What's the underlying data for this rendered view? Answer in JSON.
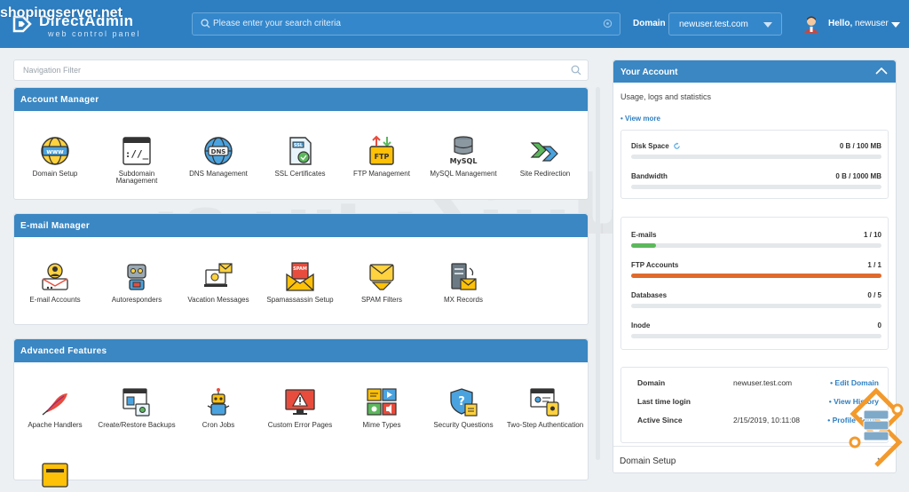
{
  "header": {
    "watermark": "shopingserver.net",
    "brand_name": "DirectAdmin",
    "brand_sub": "web control panel",
    "search_placeholder": "Please enter your search criteria",
    "domain_label": "Domain",
    "domain_value": "newuser.test.com",
    "hello": "Hello,",
    "username": "newuser"
  },
  "nav_filter": {
    "placeholder": "Navigation Filter"
  },
  "sections": [
    {
      "title": "Account Manager",
      "items": [
        {
          "label": "Domain Setup",
          "icon": "www-globe-icon"
        },
        {
          "label": "Subdomain Management",
          "icon": "subdomain-window-icon"
        },
        {
          "label": "DNS Management",
          "icon": "dns-globe-icon"
        },
        {
          "label": "SSL Certificates",
          "icon": "ssl-certificate-icon"
        },
        {
          "label": "FTP Management",
          "icon": "ftp-folder-icon"
        },
        {
          "label": "MySQL Management",
          "icon": "mysql-database-icon"
        },
        {
          "label": "Site Redirection",
          "icon": "redirect-arrows-icon"
        }
      ]
    },
    {
      "title": "E-mail Manager",
      "items": [
        {
          "label": "E-mail Accounts",
          "icon": "email-account-icon"
        },
        {
          "label": "Autoresponders",
          "icon": "robot-icon"
        },
        {
          "label": "Vacation Messages",
          "icon": "vacation-laptop-icon"
        },
        {
          "label": "Spamassassin Setup",
          "icon": "spam-envelope-icon"
        },
        {
          "label": "SPAM Filters",
          "icon": "spam-filter-icon"
        },
        {
          "label": "MX Records",
          "icon": "mx-server-icon"
        }
      ]
    },
    {
      "title": "Advanced Features",
      "items": [
        {
          "label": "Apache Handlers",
          "icon": "apache-feather-icon"
        },
        {
          "label": "Create/Restore Backups",
          "icon": "backup-window-icon"
        },
        {
          "label": "Cron Jobs",
          "icon": "cron-robot-icon"
        },
        {
          "label": "Custom Error Pages",
          "icon": "error-monitor-icon"
        },
        {
          "label": "Mime Types",
          "icon": "mime-types-icon"
        },
        {
          "label": "Security Questions",
          "icon": "security-question-icon"
        },
        {
          "label": "Two-Step Authentication",
          "icon": "two-step-auth-icon"
        }
      ]
    }
  ],
  "account": {
    "title": "Your Account",
    "description": "Usage, logs and statistics",
    "view_more": "• View more",
    "usage_top": [
      {
        "name": "Disk Space",
        "value": "0 B / 100 MB",
        "fraction": 0
      },
      {
        "name": "Bandwidth",
        "value": "0 B / 1000 MB",
        "fraction": 0
      }
    ],
    "usage_bottom": [
      {
        "name": "E-mails",
        "value": "1 / 10",
        "fraction": 0.1,
        "color": "#5cb85c"
      },
      {
        "name": "FTP Accounts",
        "value": "1 / 1",
        "fraction": 1,
        "color": "#e06a2c"
      },
      {
        "name": "Databases",
        "value": "0 / 5",
        "fraction": 0,
        "color": "#5cb85c"
      },
      {
        "name": "Inode",
        "value": "0",
        "fraction": 0,
        "color": "#5cb85c"
      }
    ],
    "info": [
      {
        "key": "Domain",
        "value": "newuser.test.com",
        "action": "• Edit Domain"
      },
      {
        "key": "Last time login",
        "value": "",
        "action": "• View History"
      },
      {
        "key": "Active Since",
        "value": "2/15/2019, 10:11:08",
        "action": "• Profile Setup"
      }
    ],
    "domain_setup": "Domain Setup"
  },
  "watermark_fa": "شاپینگ سرور",
  "colors": {
    "header": "#2e7fc2",
    "panel_header": "#3a87c3",
    "link": "#2e7fc2"
  }
}
